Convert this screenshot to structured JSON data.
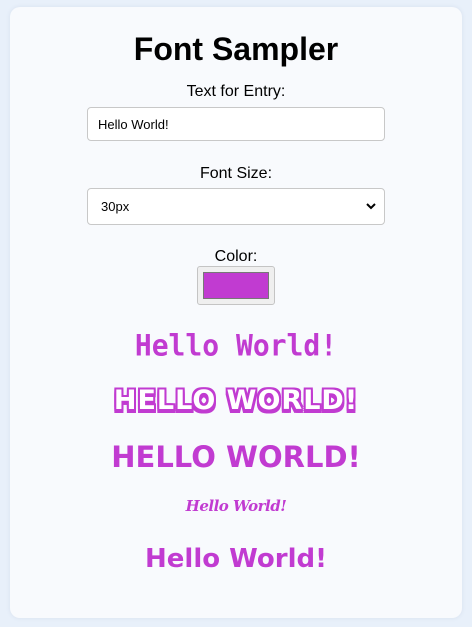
{
  "app": {
    "title": "Font Sampler"
  },
  "entry": {
    "label": "Text for Entry:",
    "value": "Hello World!"
  },
  "font_size": {
    "label": "Font Size:",
    "selected": "30px"
  },
  "color": {
    "label": "Color:",
    "value": "#c13bd1"
  },
  "samples": [
    {
      "text": "Hello World!"
    },
    {
      "text": "HELLO WORLD!"
    },
    {
      "text": "HELLO WORLD!"
    },
    {
      "text": "Hello World!"
    },
    {
      "text": "Hello World!"
    }
  ],
  "icons": {
    "select_arrow": "chevron-down-icon"
  }
}
